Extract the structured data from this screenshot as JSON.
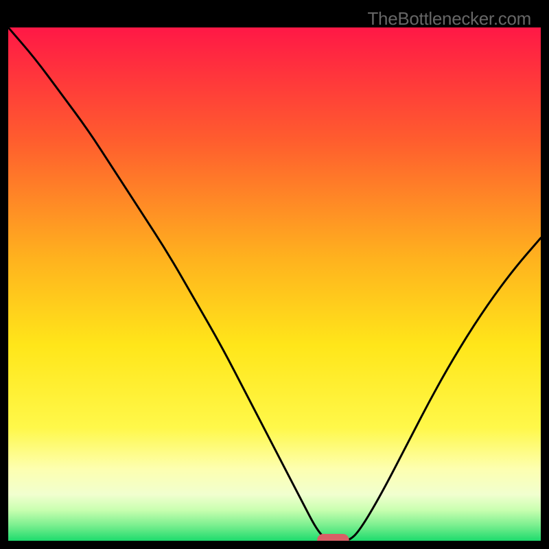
{
  "watermark": "TheBottlenecker.com",
  "chart_data": {
    "type": "line",
    "title": "",
    "xlabel": "",
    "ylabel": "",
    "xlim": [
      0,
      100
    ],
    "ylim": [
      0,
      100
    ],
    "x": [
      0,
      5,
      10,
      15,
      20,
      25,
      30,
      35,
      40,
      45,
      50,
      55,
      58,
      60,
      62,
      64,
      66,
      70,
      75,
      80,
      85,
      90,
      95,
      100
    ],
    "y": [
      100,
      94,
      87,
      80,
      72,
      64,
      56,
      47,
      38,
      28,
      18,
      8,
      2,
      0,
      0,
      0,
      2,
      9,
      19,
      29,
      38,
      46,
      53,
      59
    ],
    "marker": {
      "x_start": 58,
      "x_end": 64,
      "y": 0
    },
    "gradient_stops": [
      {
        "offset": 0.0,
        "color": "#ff1846"
      },
      {
        "offset": 0.22,
        "color": "#ff5d2e"
      },
      {
        "offset": 0.45,
        "color": "#ffb21e"
      },
      {
        "offset": 0.62,
        "color": "#ffe61a"
      },
      {
        "offset": 0.78,
        "color": "#fff84a"
      },
      {
        "offset": 0.86,
        "color": "#fdffb0"
      },
      {
        "offset": 0.91,
        "color": "#f1ffcf"
      },
      {
        "offset": 0.94,
        "color": "#c9ffb0"
      },
      {
        "offset": 0.97,
        "color": "#7aef8f"
      },
      {
        "offset": 1.0,
        "color": "#1edb6d"
      }
    ],
    "marker_color": "#d85f66",
    "line_color": "#000000"
  }
}
